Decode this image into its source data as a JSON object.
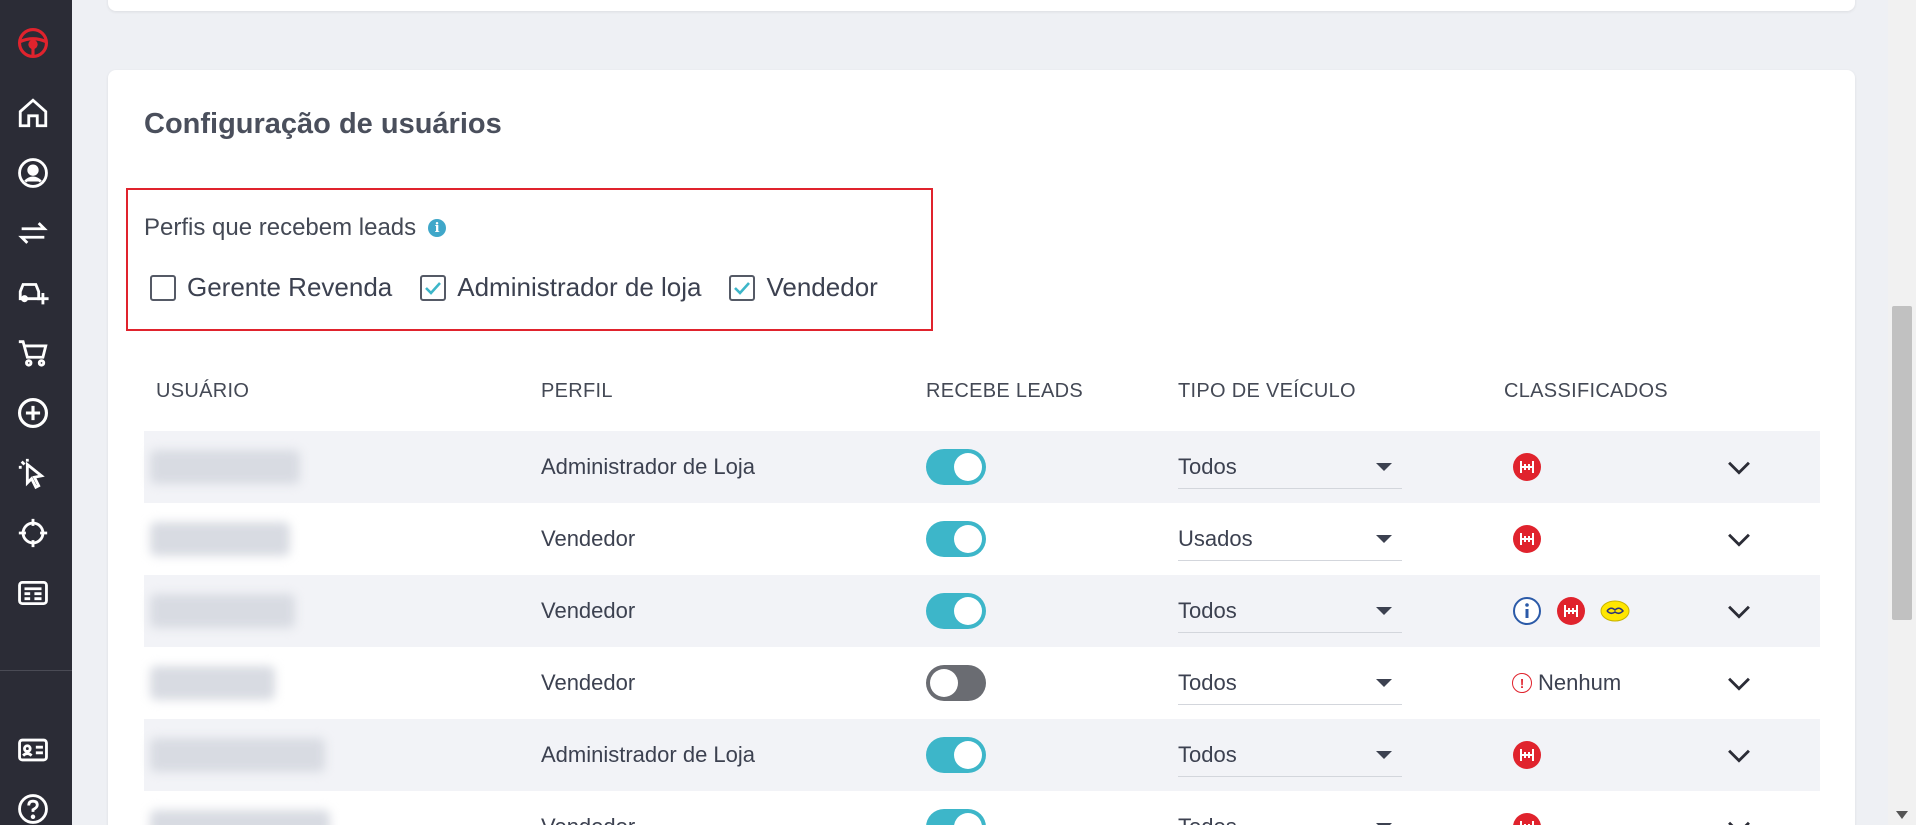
{
  "sidebar": {
    "items": [
      {
        "name": "steering-wheel-logo-icon"
      },
      {
        "name": "home-icon"
      },
      {
        "name": "user-circle-icon"
      },
      {
        "name": "transfer-arrows-icon"
      },
      {
        "name": "car-add-icon"
      },
      {
        "name": "cart-icon"
      },
      {
        "name": "plus-circle-icon"
      },
      {
        "name": "pointer-click-icon"
      },
      {
        "name": "target-icon"
      },
      {
        "name": "newspaper-icon"
      },
      {
        "name": "id-card-icon"
      },
      {
        "name": "help-icon"
      }
    ]
  },
  "section": {
    "title": "Configuração de usuários",
    "profiles_label": "Perfis que recebem leads",
    "info_glyph": "i",
    "profiles": [
      {
        "label": "Gerente Revenda",
        "checked": false
      },
      {
        "label": "Administrador de loja",
        "checked": true
      },
      {
        "label": "Vendedor",
        "checked": true
      }
    ]
  },
  "table": {
    "headers": {
      "user": "USUÁRIO",
      "profile": "PERFIL",
      "receives": "RECEBE LEADS",
      "vehicle": "TIPO DE VEÍCULO",
      "classifieds": "CLASSIFICADOS"
    },
    "rows": [
      {
        "profile": "Administrador de Loja",
        "receives": true,
        "vehicle": "Todos",
        "classifieds": [
          "webmotors"
        ]
      },
      {
        "profile": "Vendedor",
        "receives": true,
        "vehicle": "Usados",
        "classifieds": [
          "webmotors"
        ]
      },
      {
        "profile": "Vendedor",
        "receives": true,
        "vehicle": "Todos",
        "classifieds": [
          "icarros",
          "webmotors",
          "mercadolivre"
        ]
      },
      {
        "profile": "Vendedor",
        "receives": false,
        "vehicle": "Todos",
        "classifieds_none": "Nenhum"
      },
      {
        "profile": "Administrador de Loja",
        "receives": true,
        "vehicle": "Todos",
        "classifieds": [
          "webmotors"
        ]
      },
      {
        "profile": "Vendedor",
        "receives": true,
        "vehicle": "Todos",
        "classifieds": [
          "webmotors"
        ]
      }
    ]
  },
  "colors": {
    "sidebar_bg": "#2b2c36",
    "accent_red": "#e0232d",
    "toggle_on": "#3db6c9",
    "toggle_off": "#6a6c72",
    "info_blue": "#3fa7c9"
  }
}
